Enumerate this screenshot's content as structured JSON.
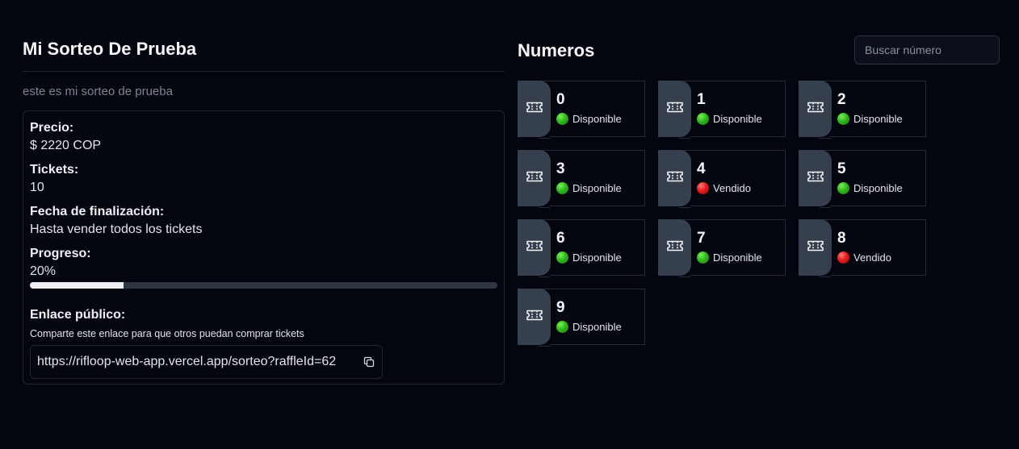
{
  "raffle": {
    "title": "Mi Sorteo De Prueba",
    "description": "este es mi sorteo de prueba",
    "price_label": "Precio:",
    "price_value": "$ 2220 COP",
    "tickets_label": "Tickets:",
    "tickets_value": "10",
    "end_date_label": "Fecha de finalización:",
    "end_date_value": "Hasta vender todos los tickets",
    "progress_label": "Progreso:",
    "progress_value": "20%",
    "progress_fraction": 0.2,
    "public_link_label": "Enlace público:",
    "public_link_helper": "Comparte este enlace para que otros puedan comprar tickets",
    "public_link_url": "https://rifloop-web-app.vercel.app/sorteo?raffleId=62"
  },
  "numbers_panel": {
    "title": "Numeros",
    "search_placeholder": "Buscar número",
    "tickets": [
      {
        "number": "0",
        "status": "Disponible",
        "state": "available"
      },
      {
        "number": "1",
        "status": "Disponible",
        "state": "available"
      },
      {
        "number": "2",
        "status": "Disponible",
        "state": "available"
      },
      {
        "number": "3",
        "status": "Disponible",
        "state": "available"
      },
      {
        "number": "4",
        "status": "Vendido",
        "state": "sold"
      },
      {
        "number": "5",
        "status": "Disponible",
        "state": "available"
      },
      {
        "number": "6",
        "status": "Disponible",
        "state": "available"
      },
      {
        "number": "7",
        "status": "Disponible",
        "state": "available"
      },
      {
        "number": "8",
        "status": "Vendido",
        "state": "sold"
      },
      {
        "number": "9",
        "status": "Disponible",
        "state": "available"
      }
    ]
  },
  "icons": {
    "ticket": "ticket-icon",
    "copy": "copy-icon"
  },
  "colors": {
    "background": "#03060f",
    "available": "#2fb81c",
    "sold": "#e51b1b",
    "stub": "#363f4d"
  }
}
